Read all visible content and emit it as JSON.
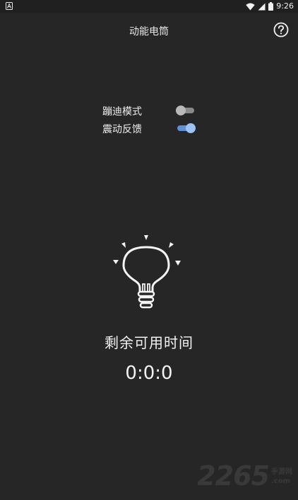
{
  "status_bar": {
    "time": "9:26",
    "icons": [
      "notification-icon",
      "wifi-icon",
      "signal-icon",
      "battery-icon"
    ]
  },
  "header": {
    "title": "动能电筒",
    "help_icon": "help-circle-icon"
  },
  "settings": [
    {
      "label": "蹦迪模式",
      "enabled": false
    },
    {
      "label": "震动反馈",
      "enabled": true
    }
  ],
  "flashlight": {
    "icon": "lightbulb-icon",
    "remain_label": "剩余可用时间",
    "remain_value": "0:0:0"
  },
  "watermark": {
    "number": "2265",
    "line1": "手游网",
    "line2": ".com"
  },
  "colors": {
    "background": "#262626",
    "toggle_on": "#9dc2f5",
    "toggle_off": "#b9b9b9"
  }
}
